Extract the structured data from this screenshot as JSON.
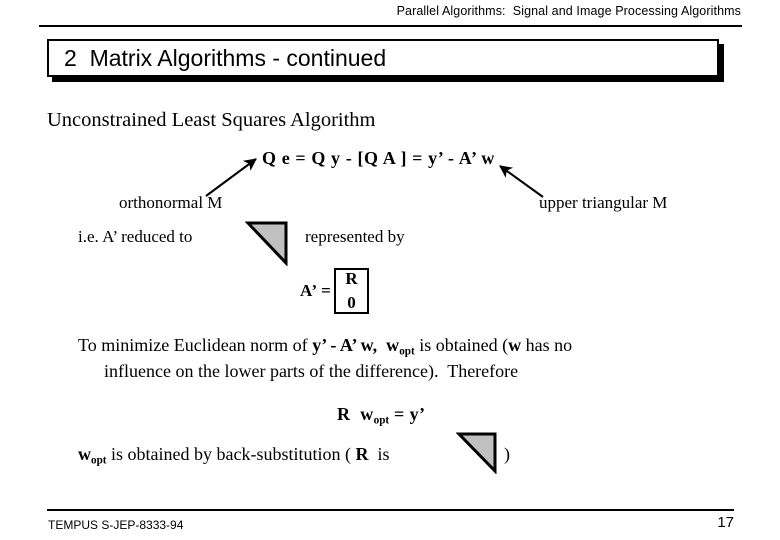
{
  "header": {
    "course_line": "Parallel Algorithms:  Signal and Image Processing Algorithms"
  },
  "title": {
    "text": "2  Matrix Algorithms - continued"
  },
  "body": {
    "section_heading": "Unconstrained Least Squares Algorithm",
    "main_equation": "Q e = Q y - [Q A ] = y’ - A’ w",
    "label_left": "orthonormal M",
    "label_right": "upper triangular M",
    "reduced_text": "i.e. A’ reduced to",
    "represented_text": "represented by",
    "matrix": {
      "lhs": "A’ =",
      "rows": [
        "R",
        "0"
      ]
    },
    "paragraph_line1_a": "To minimize Euclidean norm of ",
    "paragraph_line1_b": "y’ - A’ w,  w",
    "paragraph_line1_sub": "opt",
    "paragraph_line1_c": " is obtained (",
    "paragraph_line1_d": "w",
    "paragraph_line1_e": " has no",
    "paragraph_line2": "influence on the lower parts of the difference).  Therefore",
    "equation2_a": "R  w",
    "equation2_sub": "opt",
    "equation2_b": " = y’",
    "backsub_a": "w",
    "backsub_sub": "opt",
    "backsub_b": " is obtained by back-substitution ( ",
    "backsub_c": "R",
    "backsub_d": "  is",
    "backsub_e": ")"
  },
  "shapes": {
    "triangle_fill": "#c0c0c0",
    "triangle_stroke": "#000000",
    "triangle_name": "upper-triangular-matrix-glyph"
  },
  "footer": {
    "project": "TEMPUS S-JEP-8333-94",
    "page_number": "17"
  },
  "colors": {
    "background": "#ffffff",
    "text": "#000000",
    "rule": "#000000"
  }
}
